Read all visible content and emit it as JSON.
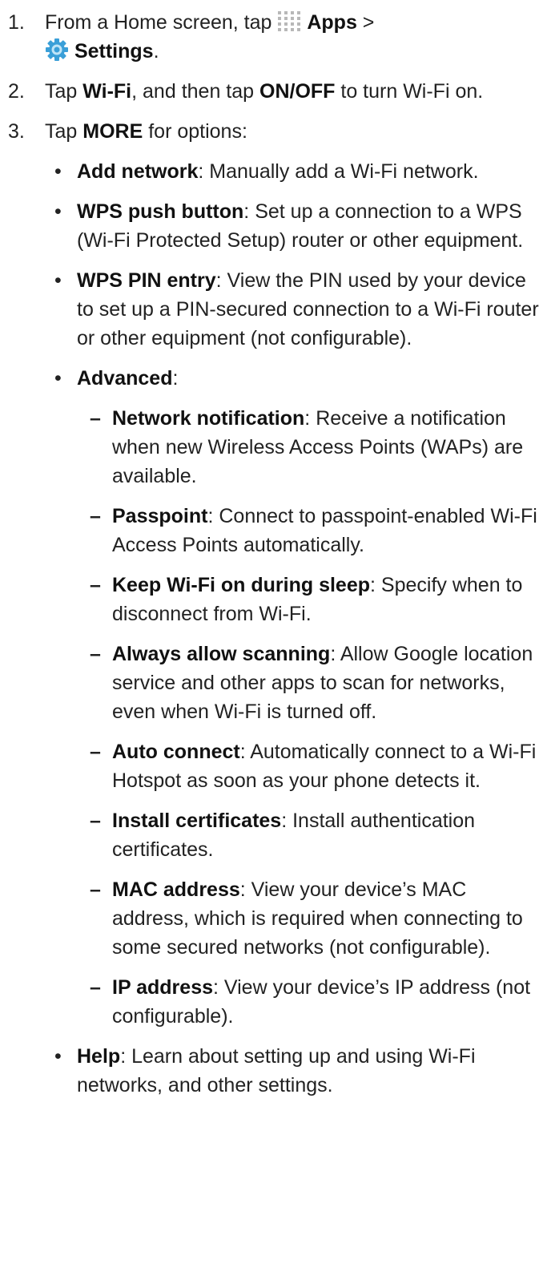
{
  "steps": [
    {
      "num": "1.",
      "text_1": "From a Home screen, tap",
      "apps_label": "Apps",
      "gt": ">",
      "settings_label": "Settings",
      "period": "."
    },
    {
      "num": "2.",
      "text_1": "Tap",
      "wifi_label": "Wi-Fi",
      "text_2": ", and then tap",
      "onoff_label": "ON/OFF",
      "text_3": "to turn Wi-Fi on."
    },
    {
      "num": "3.",
      "text_1": "Tap",
      "more_label": "MORE",
      "text_2": "for options:"
    }
  ],
  "options": [
    {
      "term": "Add network",
      "desc": ": Manually add a Wi-Fi network."
    },
    {
      "term": "WPS push button",
      "desc": ": Set up a connection to a WPS (Wi-Fi Protected Setup) router or other equipment."
    },
    {
      "term": "WPS PIN entry",
      "desc": ": View the PIN used by your device to set up a PIN-secured connection to a Wi-Fi router or other equipment (not configurable)."
    },
    {
      "term": "Advanced",
      "desc": ":"
    },
    {
      "term": "Help",
      "desc": ": Learn about setting up and using Wi-Fi networks, and other settings."
    }
  ],
  "advanced": [
    {
      "term": "Network notification",
      "desc": ": Receive a notification when new Wireless Access Points (WAPs) are available."
    },
    {
      "term": "Passpoint",
      "desc": ": Connect to passpoint-enabled Wi-Fi Access Points automatically."
    },
    {
      "term": "Keep Wi-Fi on during sleep",
      "desc": ": Specify when to disconnect from Wi-Fi."
    },
    {
      "term": "Always allow scanning",
      "desc": ": Allow Google location service and other apps to scan for networks, even when Wi-Fi is turned off."
    },
    {
      "term": "Auto connect",
      "desc": ": Automatically connect to a Wi-Fi Hotspot as soon as your phone detects it."
    },
    {
      "term": "Install certificates",
      "desc": ": Install authentication certificates."
    },
    {
      "term": "MAC address",
      "desc": ": View your device’s MAC address, which is required when connecting to some secured networks (not configurable)."
    },
    {
      "term": "IP address",
      "desc": ": View your device’s IP address (not configurable)."
    }
  ],
  "bullet_glyph": "•",
  "dash_glyph": "–",
  "icons": {
    "apps": "apps-grid-icon",
    "settings": "settings-gear-icon"
  },
  "colors": {
    "apps_icon": "#b8b8b8",
    "settings_icon": "#3a9fd8",
    "text": "#222222"
  }
}
